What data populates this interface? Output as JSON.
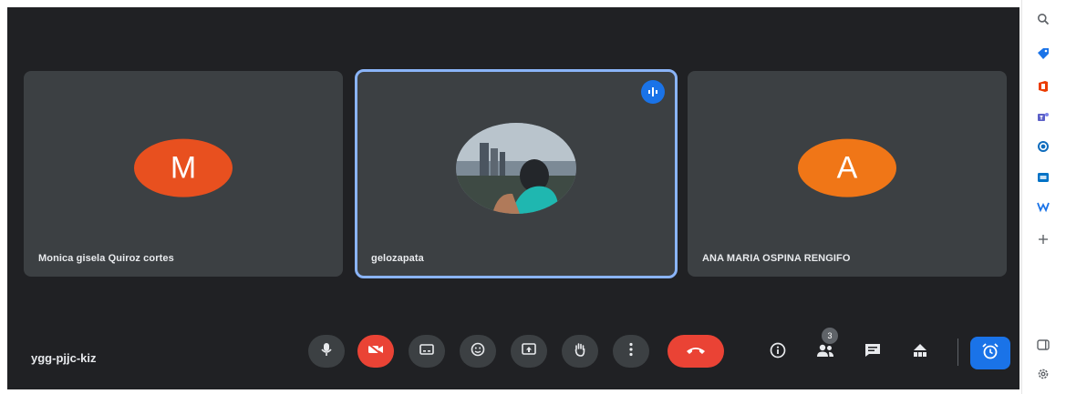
{
  "participants": [
    {
      "name": "Monica gisela Quiroz cortes",
      "initial": "M",
      "avatar_color": "#e8501f",
      "kind": "initial"
    },
    {
      "name": "gelozapata",
      "initial": "",
      "avatar_color": "#5f6368",
      "kind": "photo",
      "speaking": true
    },
    {
      "name": "ANA MARIA OSPINA RENGIFO",
      "initial": "A",
      "avatar_color": "#f07617",
      "kind": "initial"
    }
  ],
  "meeting": {
    "code": "ygg-pjjc-kiz",
    "participant_count": "3"
  },
  "controls": [
    {
      "name": "microphone-button",
      "icon": "mic-icon"
    },
    {
      "name": "camera-off-button",
      "icon": "camera-off-icon",
      "state": "off"
    },
    {
      "name": "captions-button",
      "icon": "captions-icon"
    },
    {
      "name": "reactions-button",
      "icon": "emoji-icon"
    },
    {
      "name": "present-button",
      "icon": "present-icon"
    },
    {
      "name": "raise-hand-button",
      "icon": "hand-icon"
    },
    {
      "name": "more-options-button",
      "icon": "more-vert-icon"
    },
    {
      "name": "end-call-button",
      "icon": "phone-hangup-icon"
    }
  ],
  "right_controls": [
    "info-icon",
    "people-icon",
    "chat-icon",
    "activities-icon",
    "alarm-icon"
  ],
  "side_rail_icons": [
    "search-icon",
    "tag-icon",
    "office-icon",
    "teams-icon",
    "outlook-icon",
    "word-icon",
    "add-icon",
    "sidebar-icon",
    "settings-icon"
  ],
  "colors": {
    "background": "#202124",
    "tile": "#3c4043",
    "accent": "#1a73e8",
    "danger": "#ea4335",
    "active_outline": "#8ab4f8"
  }
}
